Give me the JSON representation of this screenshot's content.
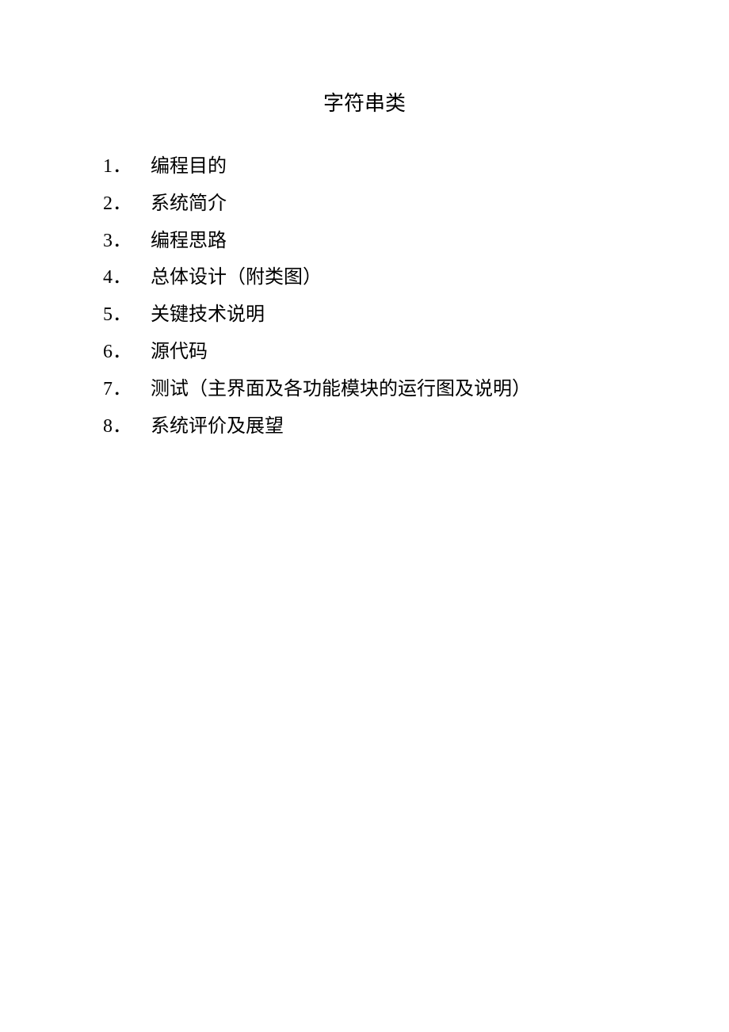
{
  "title": "字符串类",
  "toc": [
    {
      "num": "1．",
      "text": "编程目的"
    },
    {
      "num": "2．",
      "text": "系统简介"
    },
    {
      "num": "3．",
      "text": "编程思路"
    },
    {
      "num": "4．",
      "text": "总体设计（附类图）"
    },
    {
      "num": "5．",
      "text": "关键技术说明"
    },
    {
      "num": "6．",
      "text": "源代码"
    },
    {
      "num": "7．",
      "text": "测试（主界面及各功能模块的运行图及说明）"
    },
    {
      "num": "8．",
      "text": "系统评价及展望"
    }
  ]
}
